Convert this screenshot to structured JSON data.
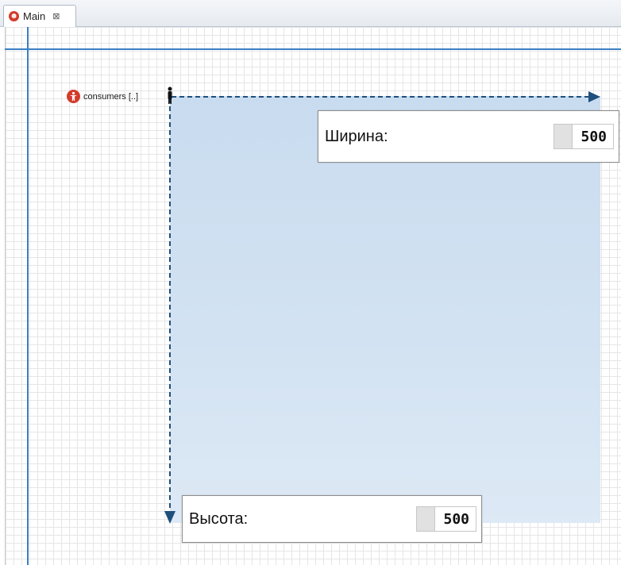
{
  "tab": {
    "label": "Main",
    "icon": "agent-icon",
    "close_glyph": "⊠"
  },
  "agent": {
    "label": "consumers [..]",
    "icon": "agent-person-icon",
    "color": "#d33b2b"
  },
  "dimensions": {
    "width": {
      "label": "Ширина:",
      "value": "500"
    },
    "height": {
      "label": "Высота:",
      "value": "500"
    }
  },
  "colors": {
    "axis": "#3b7fc4",
    "area": "#c9dcef",
    "arrow": "#1f4f7c"
  }
}
